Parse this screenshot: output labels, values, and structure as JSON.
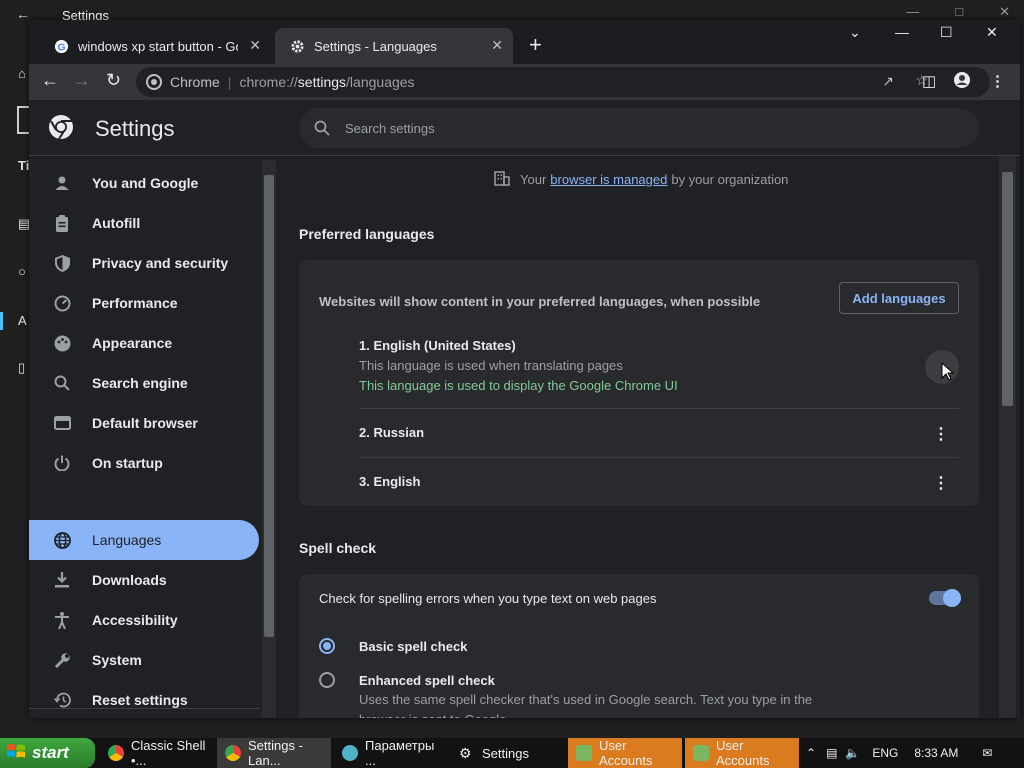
{
  "background_window": {
    "title": "Settings",
    "icons": [
      "home-icon",
      "document-icon",
      "globe-icon",
      "accessibility-icon",
      "phone-icon"
    ],
    "partial_label_1": "Ti",
    "partial_label_2": "A"
  },
  "tabs": [
    {
      "label": "windows xp start button - Google",
      "icon": "google-icon",
      "active": false
    },
    {
      "label": "Settings - Languages",
      "icon": "gear-icon",
      "active": true
    }
  ],
  "toolbar": {
    "site_label": "Chrome",
    "url_prefix": "chrome://",
    "url_path_bold": "settings",
    "url_suffix": "/languages"
  },
  "header": {
    "title": "Settings",
    "search_placeholder": "Search settings"
  },
  "sidebar": {
    "items": [
      {
        "label": "You and Google",
        "icon": "person-icon"
      },
      {
        "label": "Autofill",
        "icon": "clipboard-icon"
      },
      {
        "label": "Privacy and security",
        "icon": "shield-icon"
      },
      {
        "label": "Performance",
        "icon": "speedometer-icon"
      },
      {
        "label": "Appearance",
        "icon": "palette-icon"
      },
      {
        "label": "Search engine",
        "icon": "search-icon"
      },
      {
        "label": "Default browser",
        "icon": "browser-icon"
      },
      {
        "label": "On startup",
        "icon": "power-icon"
      },
      {
        "label": "Languages",
        "icon": "globe-icon",
        "active": true
      },
      {
        "label": "Downloads",
        "icon": "download-icon"
      },
      {
        "label": "Accessibility",
        "icon": "accessibility-icon"
      },
      {
        "label": "System",
        "icon": "wrench-icon"
      },
      {
        "label": "Reset settings",
        "icon": "restore-icon"
      }
    ]
  },
  "managed_notice": {
    "prefix": "Your",
    "link": "browser is managed",
    "suffix": "by your organization"
  },
  "preferred_languages": {
    "heading": "Preferred languages",
    "description": "Websites will show content in your preferred languages, when possible",
    "add_button": "Add languages",
    "languages": [
      {
        "name": "1. English (United States)",
        "sub": "This language is used when translating pages",
        "ui_note": "This language is used to display the Google Chrome UI"
      },
      {
        "name": "2. Russian"
      },
      {
        "name": "3. English"
      }
    ]
  },
  "spell_check": {
    "heading": "Spell check",
    "toggle_label": "Check for spelling errors when you type text on web pages",
    "toggle_on": true,
    "options": [
      {
        "label": "Basic spell check",
        "selected": true
      },
      {
        "label": "Enhanced spell check",
        "selected": false,
        "sub": "Uses the same spell checker that's used in Google search. Text you type in the browser is sent to Google."
      }
    ]
  },
  "taskbar": {
    "start_label": "start",
    "items": [
      {
        "label": "Classic Shell •...",
        "icon": "chrome-icon",
        "style": "normal"
      },
      {
        "label": "Settings - Lan...",
        "icon": "chrome-icon",
        "style": "active"
      },
      {
        "label": "Параметры ...",
        "icon": "globe-icon",
        "style": "normal"
      },
      {
        "label": "Settings",
        "icon": "gear-icon",
        "style": "normal"
      },
      {
        "label": "User Accounts",
        "icon": "users-icon",
        "style": "orange"
      },
      {
        "label": "User Accounts",
        "icon": "users-icon",
        "style": "orange"
      }
    ],
    "language": "ENG",
    "time": "8:33 AM"
  },
  "colors": {
    "accent": "#8ab4f8",
    "ui_note_green": "#81c995",
    "start_green": "#3fa83f",
    "user_accounts_orange": "#d97b1e"
  }
}
